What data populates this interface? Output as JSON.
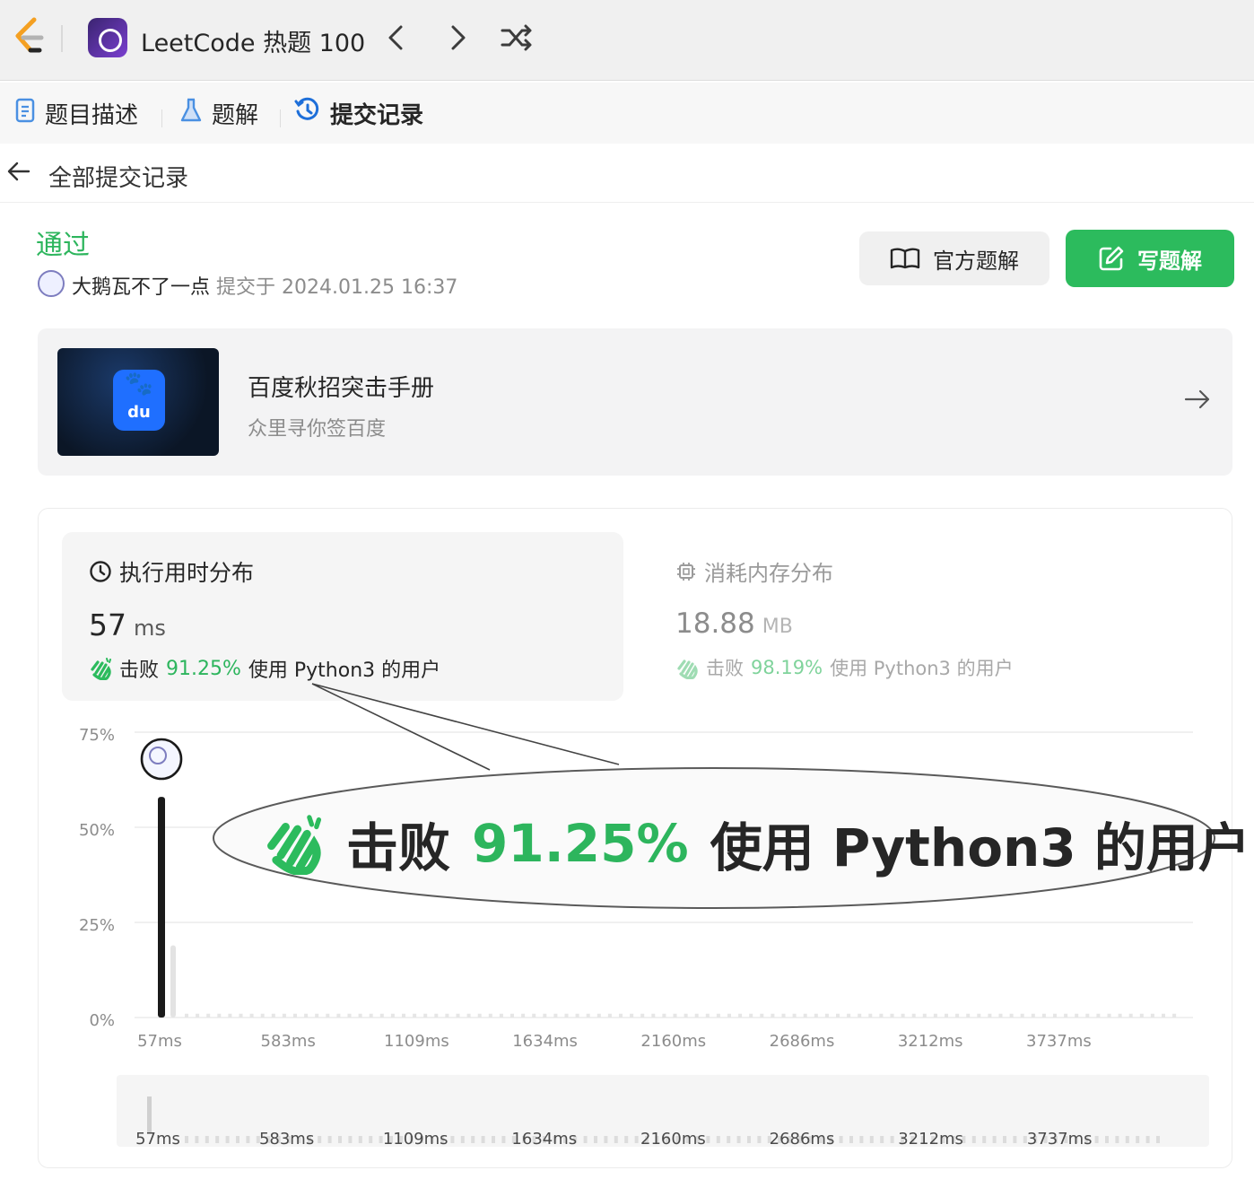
{
  "topbar": {
    "study_plan_title": "LeetCode 热题 100",
    "prev_icon": "chevron-left-icon",
    "next_icon": "chevron-right-icon",
    "shuffle_icon": "shuffle-icon"
  },
  "tabs": [
    {
      "label": "题目描述",
      "icon": "document-icon"
    },
    {
      "label": "题解",
      "icon": "flask-icon"
    },
    {
      "label": "提交记录",
      "icon": "history-icon",
      "active": true
    }
  ],
  "back": {
    "label": "全部提交记录"
  },
  "submission": {
    "status": "通过",
    "user": "大鹅瓦不了一点",
    "submitted_prefix": "提交于",
    "submitted_at": "2024.01.25 16:37"
  },
  "actions": {
    "official_solution": "官方题解",
    "write_solution": "写题解"
  },
  "banner": {
    "title": "百度秋招突击手册",
    "subtitle": "众里寻你签百度",
    "logo_text": "du"
  },
  "runtime": {
    "title": "执行用时分布",
    "value": "57",
    "unit": "ms",
    "beat_prefix": "击败",
    "beat_percent": "91.25%",
    "beat_suffix": "使用 Python3 的用户"
  },
  "memory": {
    "title": "消耗内存分布",
    "value": "18.88",
    "unit": "MB",
    "beat_prefix": "击败",
    "beat_percent": "98.19%",
    "beat_suffix": "使用 Python3 的用户"
  },
  "callout": {
    "beat_prefix": "击败",
    "beat_percent": "91.25%",
    "beat_suffix": "使用 Python3 的用户"
  },
  "colors": {
    "accent_green": "#2cbb5d",
    "text": "#262626",
    "muted": "#8c8c8c"
  },
  "chart_data": {
    "type": "bar",
    "title": "执行用时分布",
    "xlabel": "",
    "ylabel": "",
    "y_ticks": [
      "75%",
      "50%",
      "25%",
      "0%"
    ],
    "ylim": [
      0,
      75
    ],
    "x_ticks": [
      "57ms",
      "583ms",
      "1109ms",
      "1634ms",
      "2160ms",
      "2686ms",
      "3212ms",
      "3737ms"
    ],
    "xlim": [
      57,
      4700
    ],
    "bins": [
      {
        "x": 57,
        "y": 58,
        "highlight": true
      },
      {
        "x": 160,
        "y": 19
      }
    ],
    "minor_bar_count": 92,
    "minor_bar_value": 2,
    "grid": true,
    "legend": "none",
    "overview_ticks": [
      "57ms",
      "583ms",
      "1109ms",
      "1634ms",
      "2160ms",
      "2686ms",
      "3212ms",
      "3737ms"
    ]
  }
}
